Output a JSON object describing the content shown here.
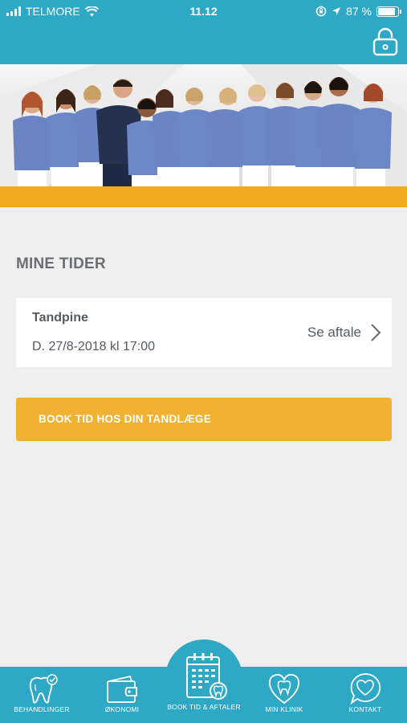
{
  "status": {
    "carrier": "TELMORE",
    "time": "11.12",
    "battery_text": "87 %",
    "battery_level": 0.87,
    "icons": [
      "signal-icon",
      "wifi-icon",
      "screen-lock-rotation-icon",
      "location-arrow-icon",
      "battery-icon"
    ]
  },
  "header": {
    "lock_icon": "padlock-icon"
  },
  "colors": {
    "primary": "#2fa8c6",
    "accent": "#f2a922",
    "button": "#f2b231",
    "background": "#efefef"
  },
  "main": {
    "section_title": "MINE TIDER",
    "appointment": {
      "title": "Tandpine",
      "date": "D. 27/8-2018 kl 17:00",
      "action_label": "Se aftale"
    },
    "book_button_label": "BOOK TID HOS DIN TANDLÆGE"
  },
  "tabbar": {
    "tabs": [
      {
        "label": "BEHANDLINGER",
        "icon": "tooth-check-icon"
      },
      {
        "label": "ØKONOMI",
        "icon": "wallet-icon"
      },
      {
        "label": "BOOK TID & AFTALER",
        "icon": "calendar-tooth-icon"
      },
      {
        "label": "MIN KLINIK",
        "icon": "heart-tooth-icon"
      },
      {
        "label": "KONTAKT",
        "icon": "chat-heart-icon"
      }
    ]
  }
}
